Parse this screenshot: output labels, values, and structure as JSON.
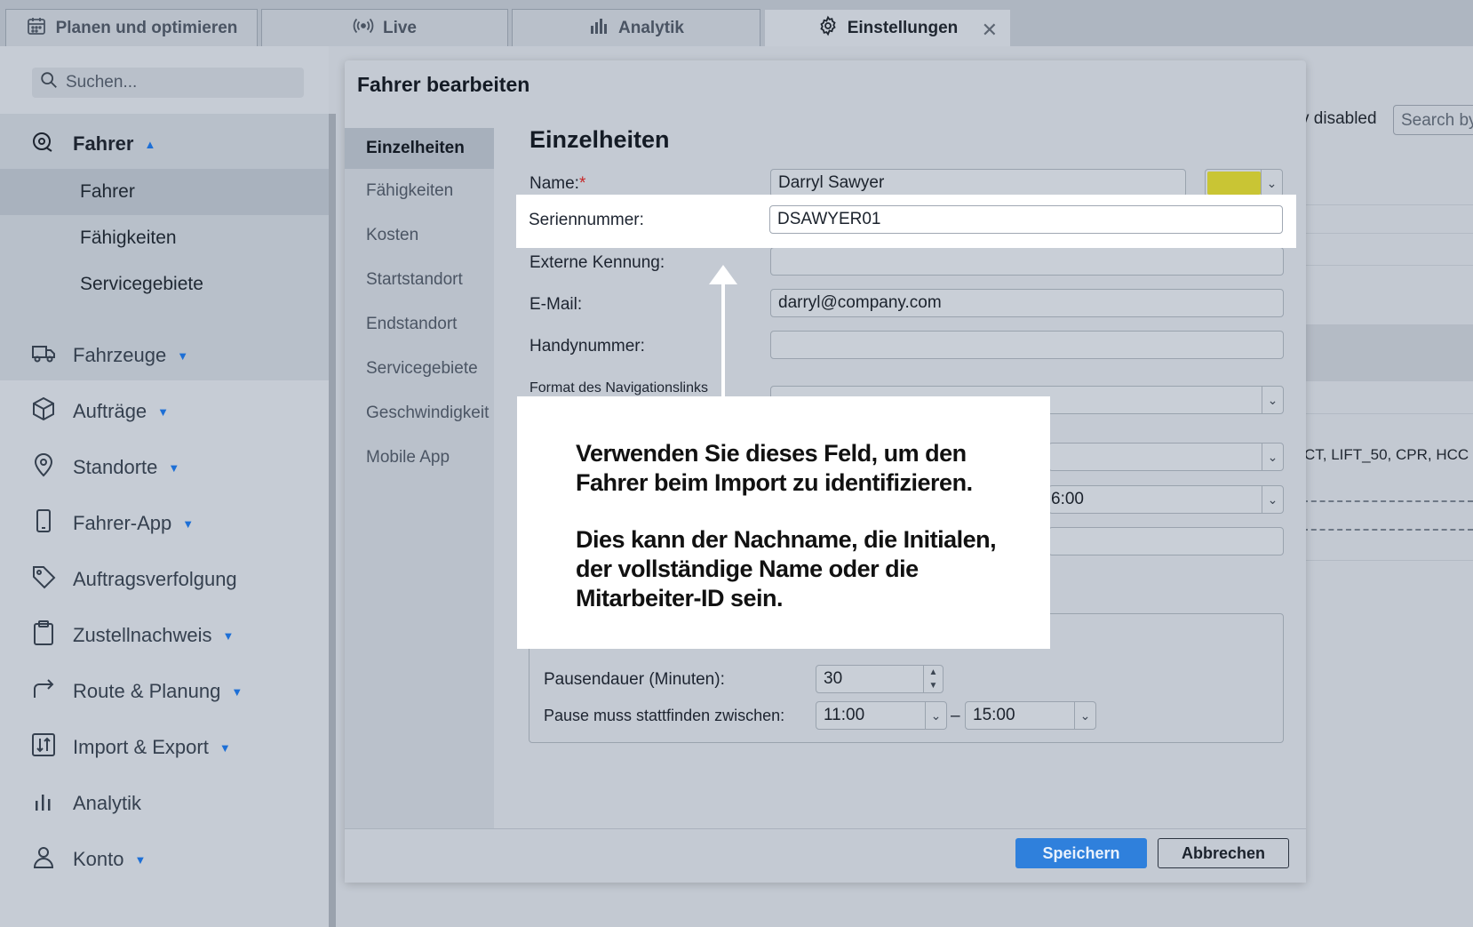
{
  "tabs": [
    {
      "label": "Planen und optimieren",
      "icon": "calendar-icon"
    },
    {
      "label": "Live",
      "icon": "broadcast-icon"
    },
    {
      "label": "Analytik",
      "icon": "bar-chart-icon"
    },
    {
      "label": "Einstellungen",
      "icon": "gear-icon",
      "close": "✕"
    }
  ],
  "sidebar": {
    "search_placeholder": "Suchen...",
    "sections": [
      {
        "label": "Fahrer",
        "icon": "driver-icon",
        "caret": "▲"
      },
      {
        "label": "Fahrzeuge",
        "icon": "truck-icon",
        "caret": "▼"
      },
      {
        "label": "Aufträge",
        "icon": "package-icon",
        "caret": "▼"
      },
      {
        "label": "Standorte",
        "icon": "location-pin-icon",
        "caret": "▼"
      },
      {
        "label": "Fahrer-App",
        "icon": "phone-icon",
        "caret": "▼"
      },
      {
        "label": "Auftragsverfolgung",
        "icon": "tag-icon",
        "caret": ""
      },
      {
        "label": "Zustellnachweis",
        "icon": "clipboard-icon",
        "caret": "▼"
      },
      {
        "label": "Route & Planung",
        "icon": "route-arrow-icon",
        "caret": "▼"
      },
      {
        "label": "Import & Export",
        "icon": "import-export-icon",
        "caret": "▼"
      },
      {
        "label": "Analytik",
        "icon": "analytics-icon",
        "caret": ""
      },
      {
        "label": "Konto",
        "icon": "user-icon",
        "caret": "▼"
      }
    ],
    "sub_items": [
      "Fahrer",
      "Fähigkeiten",
      "Servicegebiete"
    ]
  },
  "background": {
    "disabled_text": "v disabled",
    "search_text": "Search by",
    "tags_text": "CT, LIFT_50, CPR, HCC"
  },
  "modal": {
    "title": "Fahrer bearbeiten",
    "nav": [
      "Einzelheiten",
      "Fähigkeiten",
      "Kosten",
      "Startstandort",
      "Endstandort",
      "Servicegebiete",
      "Geschwindigkeit",
      "Mobile App"
    ],
    "section_title": "Einzelheiten",
    "fields": {
      "name_label": "Name:",
      "name_required": "*",
      "name_value": "Darryl Sawyer",
      "serial_label": "Seriennummer:",
      "serial_value": "DSAWYER01",
      "external_label": "Externe Kennung:",
      "external_value": "",
      "email_label": "E-Mail:",
      "email_value": "darryl@company.com",
      "mobile_label": "Handynummer:",
      "mobile_value": "",
      "navlink_label": "Format des Navigationslinks",
      "partial_time": "6:00",
      "color_value": "#c9c534"
    },
    "break": {
      "duration_label": "Pausendauer (Minuten):",
      "duration_value": "30",
      "between_label": "Pause muss stattfinden zwischen:",
      "from": "11:00",
      "dash": "–",
      "to": "15:00"
    },
    "save_label": "Speichern",
    "cancel_label": "Abbrechen"
  },
  "callout": {
    "line1": "Verwenden Sie dieses Feld, um den Fahrer beim Import zu identifizieren.",
    "line2": "Dies kann der Nachname, die Initialen, der vollständige Name oder die Mitarbeiter-ID sein."
  }
}
